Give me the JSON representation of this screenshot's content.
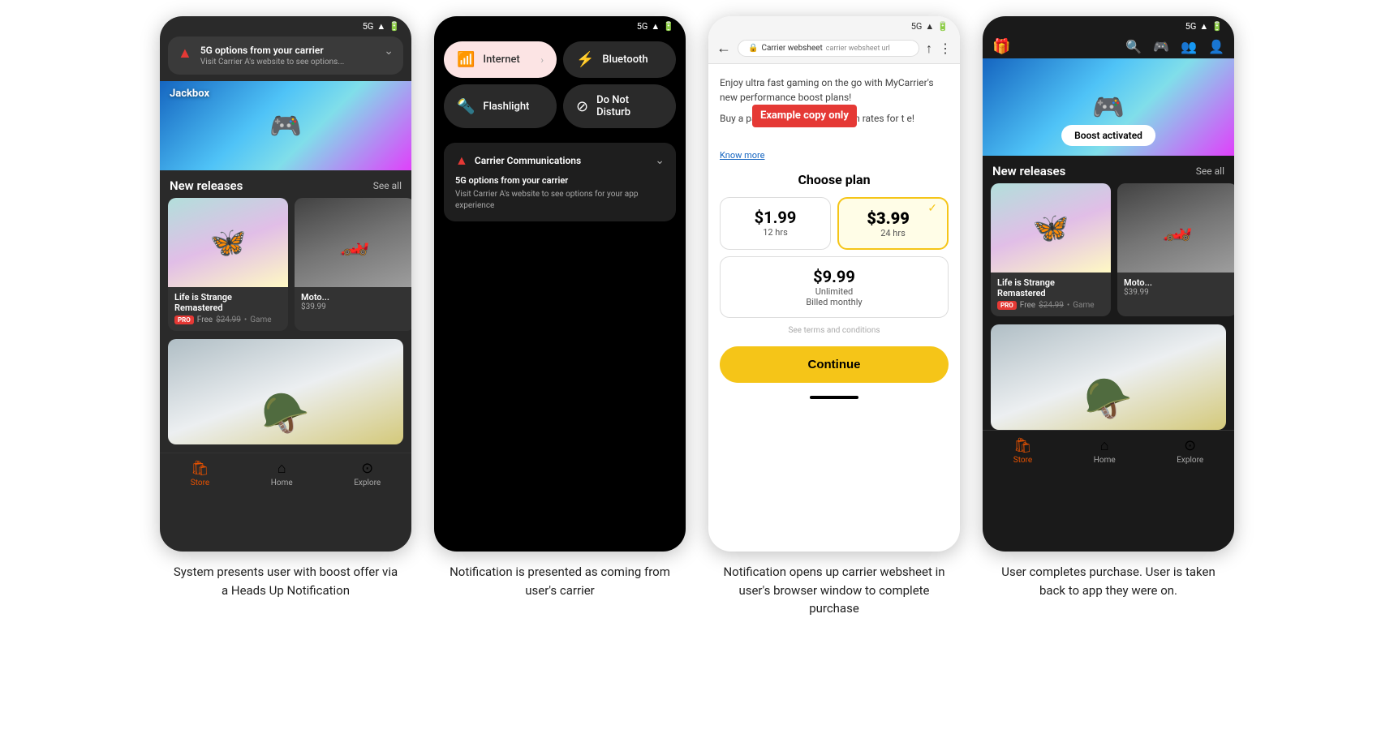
{
  "screen1": {
    "status": "5G",
    "notification": {
      "title": "5G options from your carrier",
      "subtitle": "Visit Carrier A's website to see options..."
    },
    "section": "New releases",
    "see_all": "See all",
    "game1": {
      "title": "Life is Strange Remastered",
      "badge": "PRO",
      "price_free": "Free",
      "price_original": "$24.99",
      "type": "Game"
    },
    "game2": {
      "title": "Moto...",
      "price": "$39.99"
    },
    "nav": {
      "store": "Store",
      "home": "Home",
      "explore": "Explore"
    }
  },
  "screen2": {
    "status": "5G",
    "tiles": {
      "internet": "Internet",
      "bluetooth": "Bluetooth",
      "flashlight": "Flashlight",
      "do_not_disturb": "Do Not Disturb"
    },
    "carrier": {
      "title": "Carrier Communications",
      "msg_title": "5G options from your carrier",
      "msg_body": "Visit Carrier A's website to see options for your app experience"
    }
  },
  "screen3": {
    "status": "5G",
    "url": "carrier websheet url",
    "site_title": "Carrier websheet",
    "promo": "Enjoy ultra fast gaming on the go with MyCarrier's new performance boost plans!",
    "promo2": "Buy a pass to enjoy ultra fast g n rates for t e!",
    "example_badge": "Example copy only",
    "know_more": "Know more",
    "choose_plan": "Choose plan",
    "plans": [
      {
        "price": "$1.99",
        "duration": "12 hrs",
        "selected": false
      },
      {
        "price": "$3.99",
        "duration": "24 hrs",
        "selected": true
      }
    ],
    "plan_unlimited": {
      "price": "$9.99",
      "label": "Unlimited",
      "billing": "Billed monthly"
    },
    "terms": "See terms and conditions",
    "continue_btn": "Continue"
  },
  "screen4": {
    "status": "5G",
    "boost_toast": "Boost activated",
    "section": "New releases",
    "see_all": "See all",
    "game1": {
      "title": "Life is Strange Remastered",
      "badge": "PRO",
      "price_free": "Free",
      "price_original": "$24.99",
      "type": "Game"
    },
    "game2": {
      "title": "Moto...",
      "price": "$39.99"
    },
    "nav": {
      "store": "Store",
      "home": "Home",
      "explore": "Explore"
    }
  },
  "captions": {
    "cap1": "System presents user with boost offer via a Heads Up Notification",
    "cap2": "Notification is presented as coming from user's carrier",
    "cap3": "Notification opens up carrier websheet in user's browser window to complete purchase",
    "cap4": "User completes purchase. User is taken back to app they were on."
  }
}
